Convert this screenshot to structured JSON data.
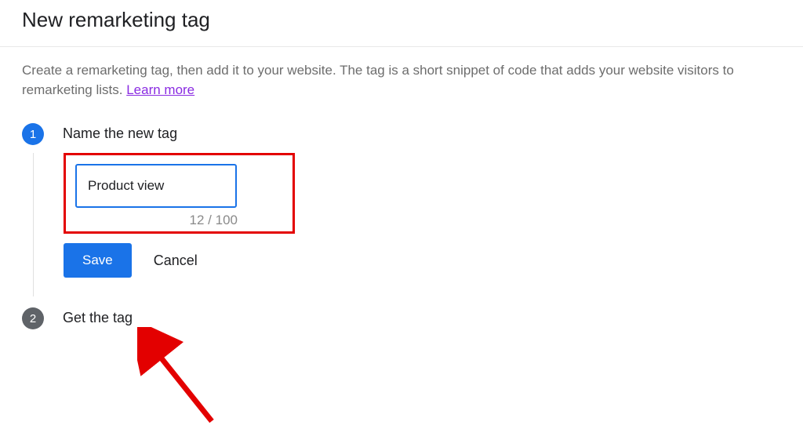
{
  "header": {
    "title": "New remarketing tag"
  },
  "description": {
    "text": "Create a remarketing tag, then add it to your website. The tag is a short snippet of code that adds your website visitors to remarketing lists. ",
    "learn_more": "Learn more"
  },
  "steps": {
    "step1": {
      "number": "1",
      "title": "Name the new tag",
      "input_value": "Product view",
      "char_count": "12 / 100",
      "save_label": "Save",
      "cancel_label": "Cancel"
    },
    "step2": {
      "number": "2",
      "title": "Get the tag"
    }
  }
}
